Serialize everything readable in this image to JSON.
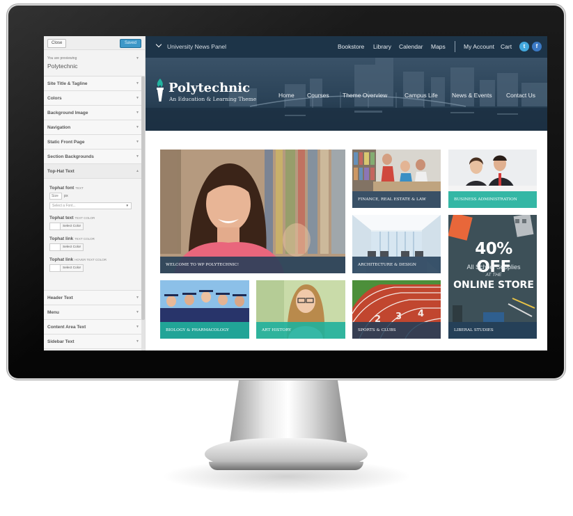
{
  "customizer": {
    "close_label": "Close",
    "saved_label": "Saved",
    "previewing_label": "You are previewing",
    "theme_name": "Polytechnic",
    "sections_top": [
      {
        "label": "Site Title & Tagline"
      },
      {
        "label": "Colors"
      },
      {
        "label": "Background Image"
      },
      {
        "label": "Navigation"
      },
      {
        "label": "Static Front Page"
      },
      {
        "label": "Section Backgrounds"
      }
    ],
    "open_section": {
      "label": "Top-Hat Text",
      "tophat_font_label": "Tophat font",
      "tophat_font_tag": "TEXT",
      "size_placeholder": "Size",
      "size_unit": "px",
      "font_select_placeholder": "Select a Font...",
      "tophat_text_label": "Tophat text",
      "tophat_text_tag": "TEXT COLOR",
      "tophat_link_label": "Tophat link",
      "tophat_link_tag": "TEXT COLOR",
      "tophat_link_hover_label": "Tophat link",
      "tophat_link_hover_tag": "HOVER TEXT COLOR",
      "select_color_label": "Select Color"
    },
    "sections_bottom": [
      {
        "label": "Header Text"
      },
      {
        "label": "Menu"
      },
      {
        "label": "Content Area Text"
      },
      {
        "label": "Sidebar Text"
      }
    ]
  },
  "site": {
    "topbar": {
      "panel_label": "University News Panel",
      "links": [
        "Bookstore",
        "Library",
        "Calendar",
        "Maps"
      ],
      "account_links": [
        "My Account",
        "Cart"
      ],
      "social": [
        {
          "icon": "twitter-icon",
          "glyph": "t"
        },
        {
          "icon": "facebook-icon",
          "glyph": "f"
        }
      ]
    },
    "logo": {
      "name": "Polytechnic",
      "tagline": "An Education & Learning Theme"
    },
    "nav": [
      "Home",
      "Courses",
      "Theme Overview",
      "Campus Life",
      "News & Events",
      "Contact Us"
    ],
    "tiles": [
      {
        "caption": "WELCOME TO WP POLYTECHNIC!"
      },
      {
        "caption": "FINANCE, REAL ESTATE & LAW"
      },
      {
        "caption": "BUSINESS ADMINISTRATION"
      },
      {
        "caption": "ARCHITECTURE & DESIGN"
      },
      {
        "caption": "BIOLOGY & PHARMACOLOGY"
      },
      {
        "caption": "ART HISTORY"
      },
      {
        "caption": "SPORTS & CLUBS"
      },
      {
        "caption": "LIBERAL STUDIES"
      }
    ],
    "promo": {
      "big": "40% OFF",
      "mid": "All School Supplies",
      "at": "AT THE",
      "store": "ONLINE STORE"
    }
  },
  "colors": {
    "topbar": "#1d3448",
    "caption_navy": "#223e58",
    "caption_teal": "#20b09c",
    "saved_button": "#3d98c8"
  }
}
